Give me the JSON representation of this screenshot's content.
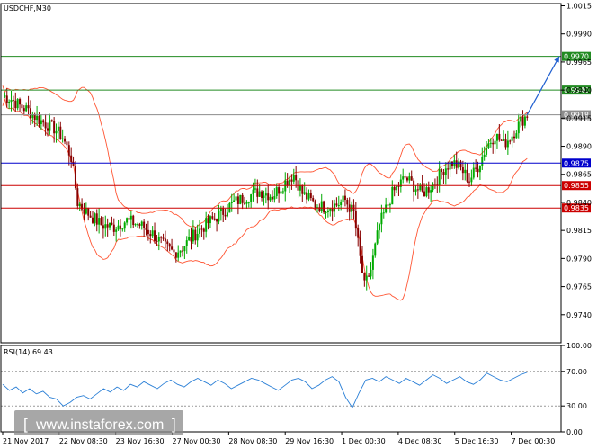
{
  "title": "USDCHF,M30",
  "rsi_label": "RSI(14) 69.43",
  "watermark": "www.instaforex.com",
  "colors": {
    "candle_up": "#00aa00",
    "candle_down": "#880000",
    "bollinger": "#ff5533",
    "rsi_line": "#2a7fd6",
    "support_blue": "#0000cc",
    "support_red": "#cc0000",
    "resistance_green": "#228b22",
    "current_price": "#8c8c8c",
    "forecast_arrow": "#1f5fd0"
  },
  "chart_data": [
    {
      "type": "candlestick",
      "title": "USDCHF,M30",
      "ylim": [
        0.9715,
        1.0017
      ],
      "y_ticks": [
        "1.0015",
        "0.9990",
        "0.9965",
        "0.9940",
        "0.9915",
        "0.9890",
        "0.9865",
        "0.9840",
        "0.9815",
        "0.9790",
        "0.9765",
        "0.9740"
      ],
      "x_ticks": [
        "21 Nov 2017",
        "22 Nov 08:30",
        "23 Nov 16:30",
        "27 Nov 00:30",
        "28 Nov 08:30",
        "29 Nov 16:30",
        "1 Dec 00:30",
        "4 Dec 08:30",
        "5 Dec 16:30",
        "7 Dec 00:30"
      ],
      "horizontal_levels": [
        {
          "label": "0.9970",
          "value": 0.997,
          "color": "resistance_green"
        },
        {
          "label": "0.9940",
          "value": 0.994,
          "color": "resistance_green"
        },
        {
          "label": "0.9918",
          "value": 0.9918,
          "color": "current_price"
        },
        {
          "label": "0.9875",
          "value": 0.9875,
          "color": "support_blue"
        },
        {
          "label": "0.9855",
          "value": 0.9855,
          "color": "support_red"
        },
        {
          "label": "0.9835",
          "value": 0.9835,
          "color": "support_red"
        }
      ],
      "close_path": [
        [
          0,
          0.9935
        ],
        [
          4,
          0.9932
        ],
        [
          8,
          0.9926
        ],
        [
          12,
          0.9922
        ],
        [
          16,
          0.9915
        ],
        [
          20,
          0.991
        ],
        [
          24,
          0.9906
        ],
        [
          28,
          0.9898
        ],
        [
          32,
          0.988
        ],
        [
          35,
          0.984
        ],
        [
          40,
          0.983
        ],
        [
          46,
          0.982
        ],
        [
          52,
          0.9818
        ],
        [
          58,
          0.9824
        ],
        [
          64,
          0.982
        ],
        [
          70,
          0.9812
        ],
        [
          76,
          0.98
        ],
        [
          80,
          0.9795
        ],
        [
          84,
          0.98
        ],
        [
          90,
          0.9812
        ],
        [
          96,
          0.9822
        ],
        [
          102,
          0.983
        ],
        [
          108,
          0.984
        ],
        [
          114,
          0.9845
        ],
        [
          120,
          0.985
        ],
        [
          126,
          0.9846
        ],
        [
          132,
          0.9858
        ],
        [
          136,
          0.9865
        ],
        [
          140,
          0.9848
        ],
        [
          146,
          0.9838
        ],
        [
          150,
          0.9836
        ],
        [
          156,
          0.9838
        ],
        [
          160,
          0.9842
        ],
        [
          164,
          0.983
        ],
        [
          167,
          0.979
        ],
        [
          169,
          0.9765
        ],
        [
          172,
          0.978
        ],
        [
          176,
          0.982
        ],
        [
          182,
          0.9848
        ],
        [
          188,
          0.9862
        ],
        [
          192,
          0.9855
        ],
        [
          196,
          0.9848
        ],
        [
          202,
          0.9858
        ],
        [
          206,
          0.987
        ],
        [
          210,
          0.9876
        ],
        [
          214,
          0.987
        ],
        [
          218,
          0.986
        ],
        [
          222,
          0.9872
        ],
        [
          226,
          0.989
        ],
        [
          230,
          0.99
        ],
        [
          234,
          0.9892
        ],
        [
          238,
          0.99
        ],
        [
          242,
          0.9912
        ],
        [
          245,
          0.9918
        ]
      ],
      "forecast": {
        "from": [
          245,
          0.9918
        ],
        "to": [
          260,
          0.997
        ]
      }
    },
    {
      "type": "line",
      "title": "RSI(14) 69.43",
      "ylim": [
        0,
        100
      ],
      "y_ticks": [
        "100.00",
        "70.00",
        "30.00",
        "0.00"
      ],
      "levels": [
        70,
        30
      ],
      "values": [
        55,
        48,
        52,
        45,
        50,
        44,
        47,
        40,
        38,
        30,
        34,
        40,
        42,
        38,
        44,
        50,
        46,
        52,
        48,
        55,
        52,
        58,
        54,
        50,
        56,
        60,
        55,
        52,
        58,
        62,
        58,
        54,
        60,
        56,
        50,
        54,
        58,
        62,
        60,
        56,
        52,
        48,
        54,
        60,
        62,
        58,
        50,
        54,
        60,
        64,
        58,
        40,
        28,
        45,
        60,
        62,
        58,
        64,
        60,
        56,
        62,
        58,
        54,
        60,
        66,
        62,
        56,
        60,
        64,
        58,
        55,
        60,
        68,
        64,
        60,
        58,
        62,
        66,
        69
      ]
    }
  ]
}
